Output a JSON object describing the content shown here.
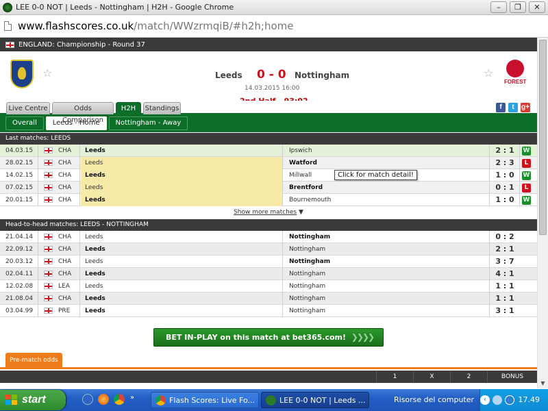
{
  "window": {
    "title": "LEE 0-0 NOT | Leeds - Nottingham | H2H - Google Chrome"
  },
  "address": {
    "host": "www.flashscores.co.uk",
    "path": "/match/WWzrmqiB/#h2h;home"
  },
  "competition": "ENGLAND: Championship - Round 37",
  "match": {
    "home": "Leeds",
    "away": "Nottingham",
    "score": "0 - 0",
    "datetime": "14.03.2015 16:00",
    "status": "2nd Half - 93:02",
    "away_crest_text": "FOREST"
  },
  "tabs": [
    "Live Centre",
    "Odds Comparison",
    "H2H",
    "Standings"
  ],
  "subtabs": [
    "Overall",
    "Leeds - Home",
    "Nottingham - Away"
  ],
  "social": {
    "facebook": "f",
    "twitter": "t",
    "gplus": "g+"
  },
  "last_matches": {
    "title": "Last matches: LEEDS",
    "rows": [
      {
        "date": "04.03.15",
        "comp": "CHA",
        "home": "Leeds",
        "away": "Ipswich",
        "score": "2 : 1",
        "result": "W"
      },
      {
        "date": "28.02.15",
        "comp": "CHA",
        "home": "Leeds",
        "away": "Watford",
        "score": "2 : 3",
        "result": "L"
      },
      {
        "date": "14.02.15",
        "comp": "CHA",
        "home": "Leeds",
        "away": "Millwall",
        "score": "1 : 0",
        "result": "W"
      },
      {
        "date": "07.02.15",
        "comp": "CHA",
        "home": "Leeds",
        "away": "Brentford",
        "score": "0 : 1",
        "result": "L"
      },
      {
        "date": "20.01.15",
        "comp": "CHA",
        "home": "Leeds",
        "away": "Bournemouth",
        "score": "1 : 0",
        "result": "W"
      }
    ],
    "show_more": "Show more matches"
  },
  "tooltip": "Click for match detail!",
  "h2h": {
    "title": "Head-to-head matches: LEEDS - NOTTINGHAM",
    "rows": [
      {
        "date": "21.04.14",
        "comp": "CHA",
        "home": "Leeds",
        "away": "Nottingham",
        "score": "0 : 2"
      },
      {
        "date": "22.09.12",
        "comp": "CHA",
        "home": "Leeds",
        "away": "Nottingham",
        "score": "2 : 1"
      },
      {
        "date": "20.03.12",
        "comp": "CHA",
        "home": "Leeds",
        "away": "Nottingham",
        "score": "3 : 7"
      },
      {
        "date": "02.04.11",
        "comp": "CHA",
        "home": "Leeds",
        "away": "Nottingham",
        "score": "4 : 1"
      },
      {
        "date": "12.02.08",
        "comp": "LEA",
        "home": "Leeds",
        "away": "Nottingham",
        "score": "1 : 1"
      },
      {
        "date": "21.08.04",
        "comp": "CHA",
        "home": "Leeds",
        "away": "Nottingham",
        "score": "1 : 1"
      },
      {
        "date": "03.04.99",
        "comp": "PRE",
        "home": "Leeds",
        "away": "Nottingham",
        "score": "3 : 1"
      }
    ]
  },
  "bet_banner": "BET IN-PLAY on this match at bet365.com!",
  "prematch_tab": "Pre-match odds",
  "odds_header": {
    "c1": "1",
    "cx": "X",
    "c2": "2",
    "bonus": "BONUS"
  },
  "taskbar": {
    "start": "start",
    "items": [
      {
        "label": "Flash Scores: Live Fo..."
      },
      {
        "label": "LEE 0-0 NOT | Leeds ..."
      },
      {
        "label": "Risorse del computer"
      }
    ],
    "clock": "17.49"
  },
  "colors": {
    "green": "#0d6e2a",
    "score_red": "#d0101b",
    "win": "#1a8f2a",
    "loss": "#d0101b",
    "orange": "#f07d1b"
  }
}
